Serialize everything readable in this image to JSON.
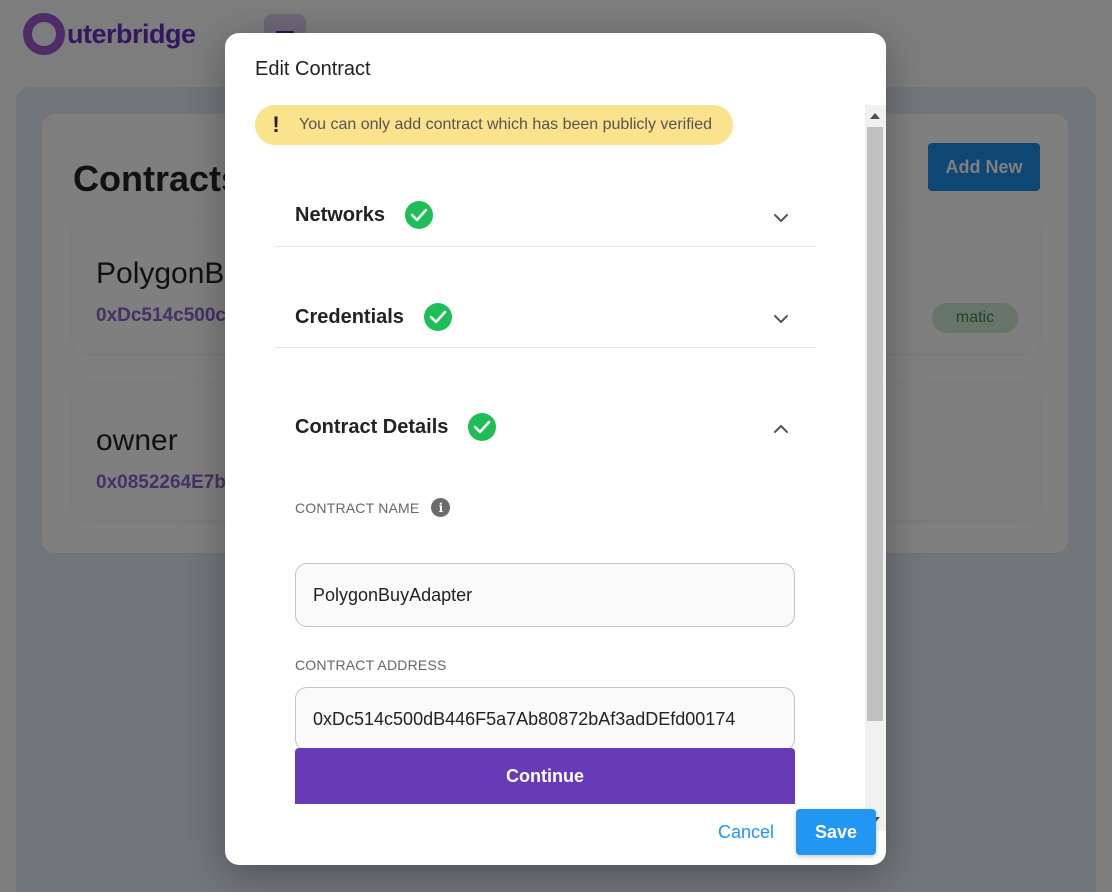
{
  "app": {
    "logo_text": "uterbridge",
    "list_title": "Contracts",
    "add_new_label": "Add New",
    "contracts": [
      {
        "name": "PolygonBu",
        "address": "0xDc514c500c",
        "network_badge": "matic"
      },
      {
        "name": "owner",
        "address": "0x0852264E7b"
      }
    ]
  },
  "modal": {
    "title": "Edit Contract",
    "alert_icon": "!",
    "alert_text": "You can only add contract which has been publicly verified",
    "sections": [
      {
        "title": "Networks",
        "status": "complete",
        "expanded": false
      },
      {
        "title": "Credentials",
        "status": "complete",
        "expanded": false
      },
      {
        "title": "Contract Details",
        "status": "complete",
        "expanded": true
      }
    ],
    "fields": {
      "contract_name_label": "CONTRACT NAME",
      "contract_name_info_icon": "i",
      "contract_name_value": "PolygonBuyAdapter",
      "contract_address_label": "CONTRACT ADDRESS",
      "contract_address_value": "0xDc514c500dB446F5a7Ab80872bAf3adDEfd00174"
    },
    "continue_label": "Continue",
    "cancel_label": "Cancel",
    "save_label": "Save"
  },
  "colors": {
    "primary": "#673ab7",
    "action_blue": "#2196f3",
    "success_green": "#1ebd55",
    "alert_yellow": "#fbe28c"
  }
}
